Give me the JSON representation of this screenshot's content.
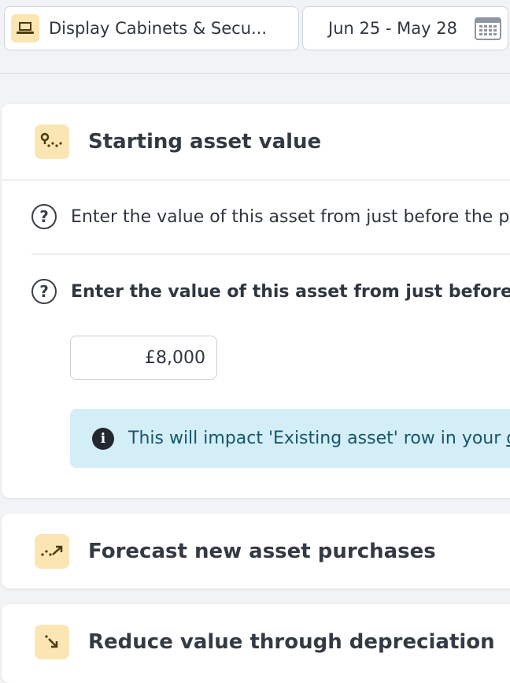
{
  "header": {
    "asset_name": "Display Cabinets & Secu...",
    "asset_icon": "laptop-icon",
    "date_range": "Jun 25 - May 28",
    "date_icon": "calendar-icon"
  },
  "starting_value": {
    "title": "Starting asset value",
    "icon": "map-pin-path-icon",
    "question_1": "Enter the value of this asset from just before the pla",
    "question_2": "Enter the value of this asset from just before the p",
    "value": "£8,000",
    "info_text": "This will impact 'Existing asset' row in your ",
    "info_link": "o"
  },
  "forecast": {
    "title": "Forecast new asset purchases",
    "icon": "trend-up-icon"
  },
  "depreciation": {
    "title": "Reduce value through depreciation",
    "icon": "arrow-down-right-icon"
  },
  "colors": {
    "icon_bg": "#fbe6b3",
    "icon_fg": "#4a3a10",
    "info_bg": "#d4eef8",
    "info_text": "#15566b"
  }
}
